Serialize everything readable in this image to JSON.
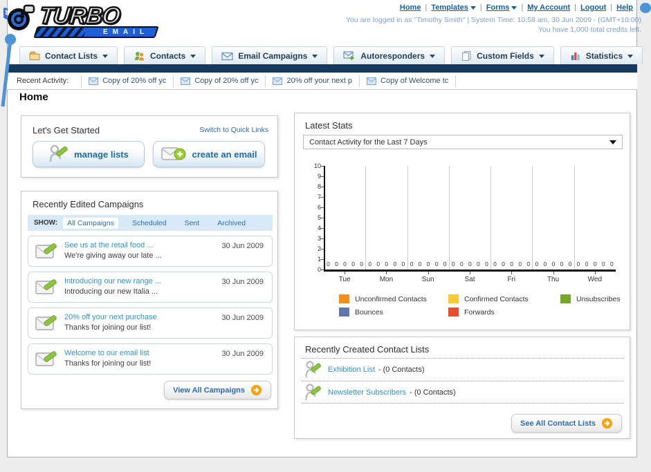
{
  "header": {
    "logo": {
      "title": "TURBO",
      "subtitle": "EMAIL"
    },
    "links": [
      {
        "label": "Home",
        "has_caret": false
      },
      {
        "label": "Templates",
        "has_caret": true
      },
      {
        "label": "Forms",
        "has_caret": true
      },
      {
        "label": "My Account",
        "has_caret": false
      },
      {
        "label": "Logout",
        "has_caret": false
      },
      {
        "label": "Help",
        "has_caret": false
      }
    ],
    "login_line": "You are logged in as \"Timothy Smith\" | System Time: 10:58 am, 30 Jun 2009 - (GMT+10:00)",
    "credits_line": "You have 1,000 total credits left."
  },
  "nav": {
    "tabs": [
      {
        "label": "Contact Lists",
        "icon": "folder-icon"
      },
      {
        "label": "Contacts",
        "icon": "contacts-icon"
      },
      {
        "label": "Email Campaigns",
        "icon": "envelope-icon"
      },
      {
        "label": "Autoresponders",
        "icon": "envelope-go-icon"
      },
      {
        "label": "Custom Fields",
        "icon": "pages-icon"
      },
      {
        "label": "Statistics",
        "icon": "barchart-icon"
      }
    ]
  },
  "recent_activity": {
    "label": "Recent Activity:",
    "items": [
      "Copy of 20% off yc",
      "Copy of 20% off yc",
      "20% off your next p",
      "Copy of Welcome tc"
    ]
  },
  "page_title": "Home",
  "get_started": {
    "title": "Let's Get Started",
    "switch_link": "Switch to Quick Links",
    "buttons": [
      {
        "label": "manage lists",
        "icon": "manage-lists-icon"
      },
      {
        "label": "create an email",
        "icon": "create-email-icon"
      }
    ]
  },
  "campaigns": {
    "title": "Recently Edited Campaigns",
    "show_label": "SHOW:",
    "filters": [
      {
        "label": "All Campaigns",
        "selected": true
      },
      {
        "label": "Scheduled",
        "selected": false
      },
      {
        "label": "Sent",
        "selected": false
      },
      {
        "label": "Archived",
        "selected": false
      }
    ],
    "items": [
      {
        "title": "See us at the retail food ...",
        "subtitle": "We're giving away our late ...",
        "date": "30 Jun 2009"
      },
      {
        "title": "Introducing our new range ...",
        "subtitle": "Introducing our new Italia ...",
        "date": "30 Jun 2009"
      },
      {
        "title": "20% off your next purchase",
        "subtitle": "Thanks for joining our list!",
        "date": "30 Jun 2009"
      },
      {
        "title": "Welcome to our email list",
        "subtitle": "Thanks for joining our list!",
        "date": "30 Jun 2009"
      }
    ],
    "view_all_label": "View All Campaigns"
  },
  "stats": {
    "title": "Latest Stats",
    "selector": "Contact Activity for the Last 7 Days"
  },
  "chart_data": {
    "type": "bar",
    "title": "Contact Activity for the Last 7 Days",
    "categories": [
      "Tue",
      "Mon",
      "Sun",
      "Sat",
      "Fri",
      "Thu",
      "Wed"
    ],
    "series": [
      {
        "name": "Unconfirmed Contacts",
        "color": "#F28E1D",
        "values": [
          0,
          0,
          0,
          0,
          0,
          0,
          0
        ]
      },
      {
        "name": "Confirmed Contacts",
        "color": "#FBC930",
        "values": [
          0,
          0,
          0,
          0,
          0,
          0,
          0
        ]
      },
      {
        "name": "Unsubscribes",
        "color": "#79A52B",
        "values": [
          0,
          0,
          0,
          0,
          0,
          0,
          0
        ]
      },
      {
        "name": "Bounces",
        "color": "#5F77AE",
        "values": [
          0,
          0,
          0,
          0,
          0,
          0,
          0
        ]
      },
      {
        "name": "Forwards",
        "color": "#E4502A",
        "values": [
          0,
          0,
          0,
          0,
          0,
          0,
          0
        ]
      }
    ],
    "ylim": [
      0,
      10
    ],
    "yticks": [
      0,
      1,
      2,
      3,
      4,
      5,
      6,
      7,
      8,
      9,
      10
    ],
    "grid": "vertical day separators",
    "legend_position": "bottom",
    "value_labels_shown": true
  },
  "contact_lists": {
    "title": "Recently Created Contact Lists",
    "items": [
      {
        "name": "Exhibition List",
        "suffix": "- (0 Contacts)"
      },
      {
        "name": "Newsletter Subscribers",
        "suffix": "- (0 Contacts)"
      }
    ],
    "see_all_label": "See All Contact Lists"
  },
  "colors": {
    "navy_bar": "#17395F",
    "link_blue": "#2E6DB4",
    "item_link_blue": "#3193C7",
    "arrow_orange": "#F5A411",
    "logo_blue": "#1E5FD6",
    "deco_blue": "#4D94D6"
  }
}
